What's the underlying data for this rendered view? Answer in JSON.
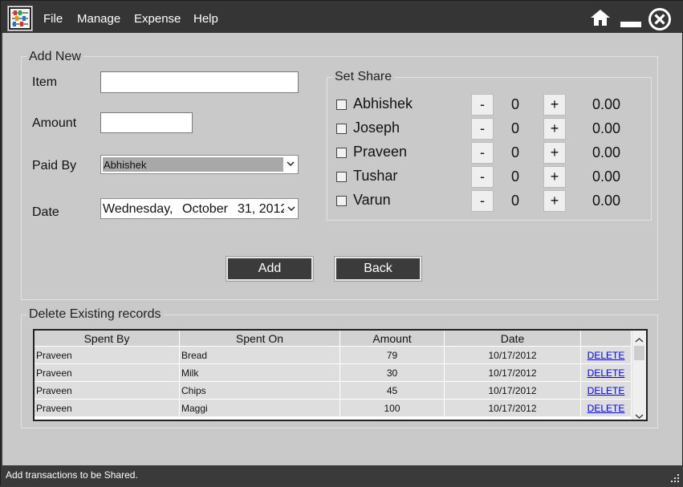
{
  "menu": {
    "file": "File",
    "manage": "Manage",
    "expense": "Expense",
    "help": "Help"
  },
  "add_new": {
    "title": "Add New",
    "item_label": "Item",
    "item_value": "",
    "amount_label": "Amount",
    "amount_value": "",
    "paid_by_label": "Paid By",
    "paid_by_value": "Abhishek",
    "date_label": "Date",
    "date_weekday": "Wednesday,",
    "date_month": "October",
    "date_day_year": "31, 2012",
    "add_button": "Add",
    "back_button": "Back"
  },
  "set_share": {
    "title": "Set Share",
    "minus": "-",
    "plus": "+",
    "people": [
      {
        "name": "Abhishek",
        "count": "0",
        "amount": "0.00"
      },
      {
        "name": "Joseph",
        "count": "0",
        "amount": "0.00"
      },
      {
        "name": "Praveen",
        "count": "0",
        "amount": "0.00"
      },
      {
        "name": "Tushar",
        "count": "0",
        "amount": "0.00"
      },
      {
        "name": "Varun",
        "count": "0",
        "amount": "0.00"
      }
    ]
  },
  "delete_existing": {
    "title": "Delete Existing records",
    "columns": [
      "Spent By",
      "Spent On",
      "Amount",
      "Date",
      ""
    ],
    "rows": [
      {
        "spent_by": "Praveen",
        "spent_on": "Bread",
        "amount": "79",
        "date": "10/17/2012",
        "action": "DELETE"
      },
      {
        "spent_by": "Praveen",
        "spent_on": "Milk",
        "amount": "30",
        "date": "10/17/2012",
        "action": "DELETE"
      },
      {
        "spent_by": "Praveen",
        "spent_on": "Chips",
        "amount": "45",
        "date": "10/17/2012",
        "action": "DELETE"
      },
      {
        "spent_by": "Praveen",
        "spent_on": "Maggi",
        "amount": "100",
        "date": "10/17/2012",
        "action": "DELETE"
      }
    ]
  },
  "status": {
    "text": "Add transactions to be Shared."
  },
  "icons": {
    "app": "abacus-icon",
    "home": "home-icon",
    "minimize": "minimize-icon",
    "close": "close-icon",
    "resize": "resize-grip-icon"
  },
  "colors": {
    "titlebar": "#353535",
    "client": "#c9c9c9",
    "button": "#3b3b3b",
    "link": "#0000ee"
  }
}
